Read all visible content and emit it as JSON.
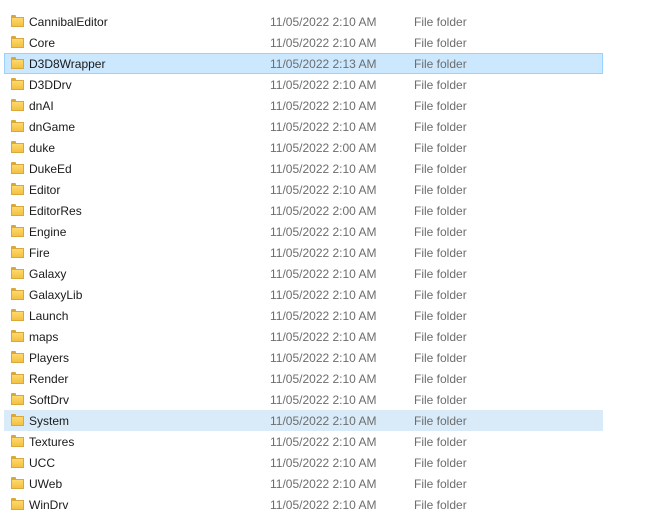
{
  "files": [
    {
      "name": "CannibalEditor",
      "date": "11/05/2022 2:10 AM",
      "type": "File folder",
      "icon": "folder-icon"
    },
    {
      "name": "Core",
      "date": "11/05/2022 2:10 AM",
      "type": "File folder",
      "icon": "folder-icon"
    },
    {
      "name": "D3D8Wrapper",
      "date": "11/05/2022 2:13 AM",
      "type": "File folder",
      "icon": "folder-icon",
      "state": "highlighted"
    },
    {
      "name": "D3DDrv",
      "date": "11/05/2022 2:10 AM",
      "type": "File folder",
      "icon": "folder-icon"
    },
    {
      "name": "dnAI",
      "date": "11/05/2022 2:10 AM",
      "type": "File folder",
      "icon": "folder-icon"
    },
    {
      "name": "dnGame",
      "date": "11/05/2022 2:10 AM",
      "type": "File folder",
      "icon": "folder-icon"
    },
    {
      "name": "duke",
      "date": "11/05/2022 2:00 AM",
      "type": "File folder",
      "icon": "folder-icon"
    },
    {
      "name": "DukeEd",
      "date": "11/05/2022 2:10 AM",
      "type": "File folder",
      "icon": "folder-icon"
    },
    {
      "name": "Editor",
      "date": "11/05/2022 2:10 AM",
      "type": "File folder",
      "icon": "folder-icon"
    },
    {
      "name": "EditorRes",
      "date": "11/05/2022 2:00 AM",
      "type": "File folder",
      "icon": "folder-icon"
    },
    {
      "name": "Engine",
      "date": "11/05/2022 2:10 AM",
      "type": "File folder",
      "icon": "folder-icon"
    },
    {
      "name": "Fire",
      "date": "11/05/2022 2:10 AM",
      "type": "File folder",
      "icon": "folder-icon"
    },
    {
      "name": "Galaxy",
      "date": "11/05/2022 2:10 AM",
      "type": "File folder",
      "icon": "folder-icon"
    },
    {
      "name": "GalaxyLib",
      "date": "11/05/2022 2:10 AM",
      "type": "File folder",
      "icon": "folder-icon"
    },
    {
      "name": "Launch",
      "date": "11/05/2022 2:10 AM",
      "type": "File folder",
      "icon": "folder-icon"
    },
    {
      "name": "maps",
      "date": "11/05/2022 2:10 AM",
      "type": "File folder",
      "icon": "folder-icon"
    },
    {
      "name": "Players",
      "date": "11/05/2022 2:10 AM",
      "type": "File folder",
      "icon": "folder-icon"
    },
    {
      "name": "Render",
      "date": "11/05/2022 2:10 AM",
      "type": "File folder",
      "icon": "folder-icon"
    },
    {
      "name": "SoftDrv",
      "date": "11/05/2022 2:10 AM",
      "type": "File folder",
      "icon": "folder-icon"
    },
    {
      "name": "System",
      "date": "11/05/2022 2:10 AM",
      "type": "File folder",
      "icon": "folder-icon",
      "state": "selected"
    },
    {
      "name": "Textures",
      "date": "11/05/2022 2:10 AM",
      "type": "File folder",
      "icon": "folder-icon"
    },
    {
      "name": "UCC",
      "date": "11/05/2022 2:10 AM",
      "type": "File folder",
      "icon": "folder-icon"
    },
    {
      "name": "UWeb",
      "date": "11/05/2022 2:10 AM",
      "type": "File folder",
      "icon": "folder-icon"
    },
    {
      "name": "WinDrv",
      "date": "11/05/2022 2:10 AM",
      "type": "File folder",
      "icon": "folder-icon"
    }
  ],
  "colors": {
    "highlight_bg": "#cce8ff",
    "highlight_border": "#99d1ff",
    "selected_bg": "#d9ebf9",
    "folder_yellow": "#ffd96a",
    "secondary_text": "#6d6d6d"
  }
}
